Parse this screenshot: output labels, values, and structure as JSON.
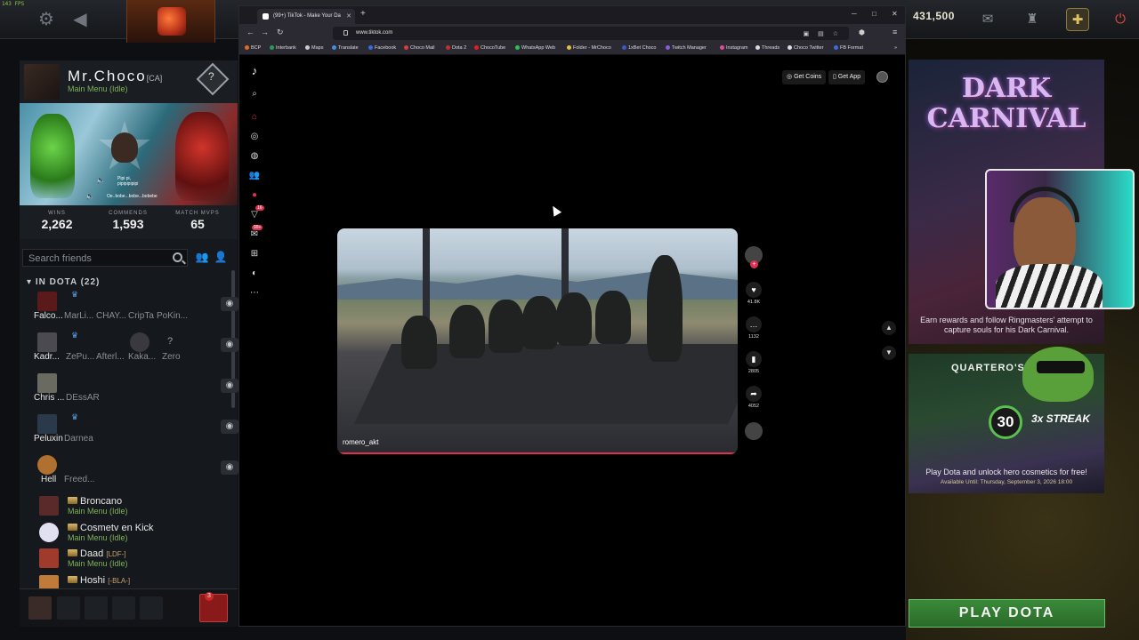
{
  "fps": "143 FPS",
  "topbar": {
    "gold": "431,500"
  },
  "profile": {
    "name": "Mr.Choco",
    "badge": "[CA]",
    "status": "Main Menu (Idle)",
    "rank_symbol": "?",
    "music_line1": "Pipi pi,",
    "music_line2": "pipipipipipi",
    "music_line3": "Oe..bobe...bobe...bobebe"
  },
  "stats": [
    {
      "label": "WINS",
      "value": "2,262"
    },
    {
      "label": "COMMENDS",
      "value": "1,593"
    },
    {
      "label": "MATCH MVPS",
      "value": "65"
    }
  ],
  "friends_search": {
    "placeholder": "Search friends"
  },
  "in_dota": {
    "header": "IN DOTA (22)"
  },
  "party_rows": [
    {
      "names": [
        "Falco...",
        "MarLi...",
        "CHAY...",
        "CripTa",
        "PoKin..."
      ]
    },
    {
      "names": [
        "Kadr...",
        "ZePu...",
        "Afterl...",
        "Kaka...",
        "Zero"
      ],
      "q": "?"
    },
    {
      "names": [
        "Chris ...",
        "DEssAR"
      ]
    },
    {
      "names": [
        "Peluxin",
        "Darnea"
      ]
    },
    {
      "names": [
        "Hell",
        "Freed..."
      ]
    }
  ],
  "friends": [
    {
      "name": "Broncano",
      "tag": "",
      "status": "Main Menu (Idle)"
    },
    {
      "name": "Cosmetv en Kick",
      "tag": "",
      "status": "Main Menu (Idle)"
    },
    {
      "name": "Daad",
      "tag": "[LDF-]",
      "status": "Main Menu (Idle)"
    },
    {
      "name": "Hoshi",
      "tag": "[-BLA-]",
      "status": ""
    }
  ],
  "left_bottom": {
    "notif_count": "3"
  },
  "browser": {
    "tab_title": "(99+) TikTok - Make Your Da",
    "url": "www.tiktok.com",
    "bookmarks": [
      "BCP",
      "Interbank",
      "Maps",
      "Translate",
      "Facebook",
      "Choco Mail",
      "Dota 2",
      "ChocoTube",
      "WhatsApp Web",
      "Folder - MrChoco",
      "1xBet Choco",
      "Twitch Manager",
      "Instagram",
      "Threads",
      "Choco Twitter",
      "FB Format"
    ]
  },
  "tiktok": {
    "get_coins": "Get Coins",
    "get_app": "Get App",
    "notif_badge": "99+",
    "msg_badge": "16",
    "video_user": "romero_akt",
    "likes": "41.8K",
    "comments": "1132",
    "saves": "2805",
    "shares": "4052"
  },
  "right": {
    "carnival_title_1": "DARK",
    "carnival_title_2": "CARNIVAL",
    "carnival_text": "Earn rewards and follow Ringmasters' attempt to capture souls for his Dark Carnival.",
    "quartero_title": "QUARTERO'S C",
    "streak_number": "30",
    "streak_label": "3x STREAK",
    "quartero_text": "Play Dota and unlock hero cosmetics for free!",
    "quartero_date": "Available Until:  Thursday, September 3, 2026 18:00",
    "play_button": "PLAY DOTA"
  },
  "colors": {
    "accent_green": "#3a8a3a",
    "tiktok_red": "#e03050",
    "online_green": "#7fb35a"
  }
}
